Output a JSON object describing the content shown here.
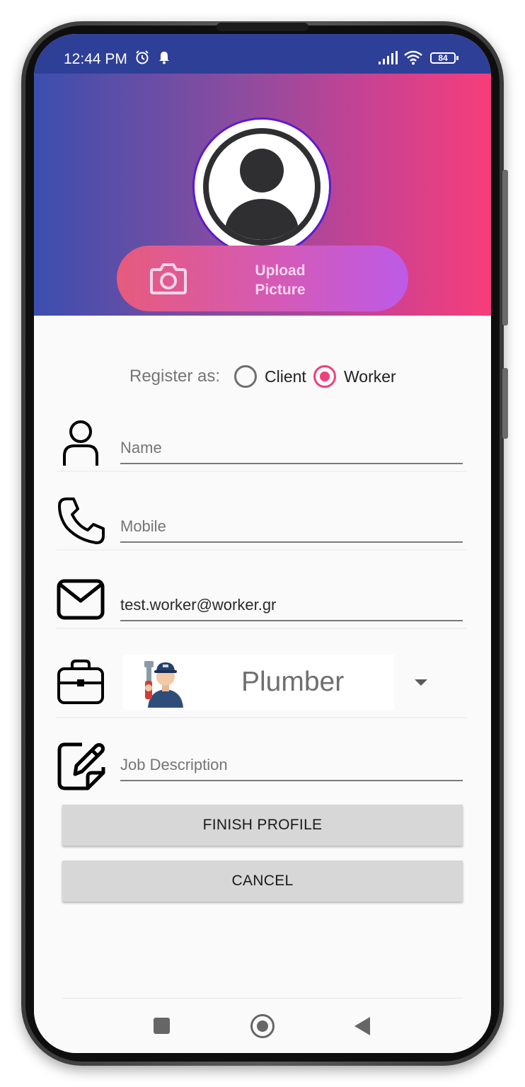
{
  "status_bar": {
    "time": "12:44 PM",
    "battery": "84",
    "icons": [
      "alarm-icon",
      "notification-bell-icon",
      "signal-icon",
      "wifi-icon",
      "battery-icon"
    ]
  },
  "header": {
    "gradient_colors": [
      "#3b4fae",
      "#c64293",
      "#f73d7a"
    ],
    "avatar_icon": "user-avatar-icon",
    "upload_button": {
      "label": "Upload\nPicture",
      "icon": "camera-icon"
    }
  },
  "register": {
    "label": "Register as:",
    "options": [
      {
        "label": "Client",
        "selected": false
      },
      {
        "label": "Worker",
        "selected": true
      }
    ],
    "accent_color": "#f0407a"
  },
  "form": {
    "name": {
      "placeholder": "Name",
      "value": "",
      "icon": "person-icon"
    },
    "mobile": {
      "placeholder": "Mobile",
      "value": "",
      "icon": "phone-icon"
    },
    "email": {
      "placeholder": "",
      "value": "test.worker@worker.gr",
      "icon": "mail-icon"
    },
    "job": {
      "selected": "Plumber",
      "icon": "briefcase-icon",
      "image": "plumber-icon"
    },
    "description": {
      "placeholder": "Job Description",
      "value": "",
      "icon": "edit-note-icon"
    }
  },
  "buttons": {
    "finish": "FINISH PROFILE",
    "cancel": "CANCEL"
  },
  "nav": {
    "icons": [
      "recents-square-icon",
      "home-circle-icon",
      "back-triangle-icon"
    ]
  }
}
